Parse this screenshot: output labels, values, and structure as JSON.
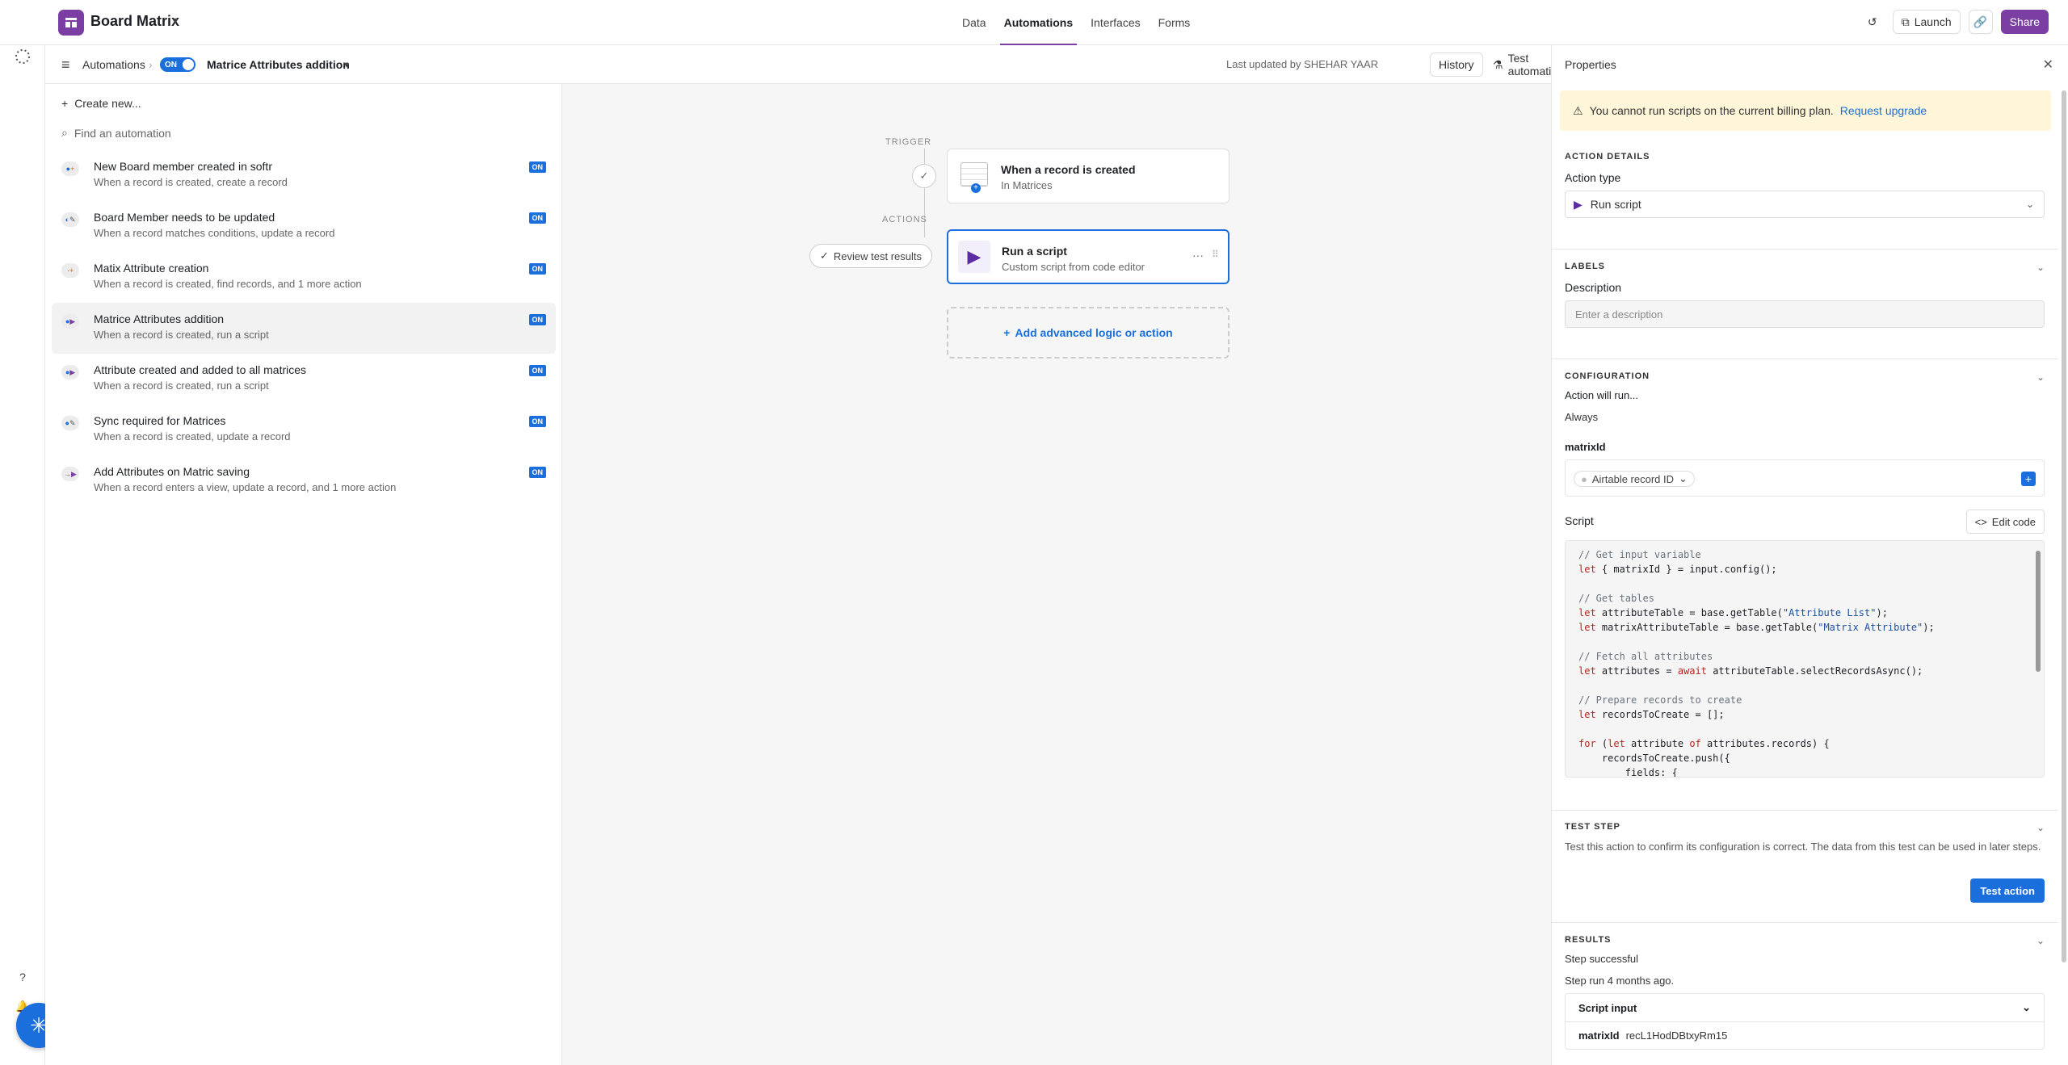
{
  "app": {
    "base_name": "Board Matrix",
    "nav_tabs": [
      "Data",
      "Automations",
      "Interfaces",
      "Forms"
    ],
    "active_tab": "Automations",
    "launch_label": "Launch",
    "share_label": "Share"
  },
  "subbar": {
    "breadcrumb": "Automations",
    "toggle_label": "ON",
    "automation_name": "Matrice Attributes addition",
    "last_updated": "Last updated by SHEHAR YAAR",
    "history_label": "History",
    "test_label": "Test automation"
  },
  "left": {
    "create_label": "Create new...",
    "find_placeholder": "Find an automation",
    "automations": [
      {
        "title": "New Board member created in softr",
        "subtitle": "When a record is created, create a record",
        "status": "ON",
        "action_icon": "plus"
      },
      {
        "title": "Board Member needs to be updated",
        "subtitle": "When a record matches conditions, update a record",
        "status": "ON",
        "action_icon": "pencil"
      },
      {
        "title": "Matix Attribute creation",
        "subtitle": "When a record is created, find records, and 1 more action",
        "status": "ON",
        "action_icon": "plus"
      },
      {
        "title": "Matrice Attributes addition",
        "subtitle": "When a record is created, run a script",
        "status": "ON",
        "action_icon": "play"
      },
      {
        "title": "Attribute created and added to all matrices",
        "subtitle": "When a record is created, run a script",
        "status": "ON",
        "action_icon": "play"
      },
      {
        "title": "Sync required for Matrices",
        "subtitle": "When a record is created, update a record",
        "status": "ON",
        "action_icon": "pencil"
      },
      {
        "title": "Add Attributes on Matric saving",
        "subtitle": "When a record enters a view, update a record, and 1 more action",
        "status": "ON",
        "action_icon": "play"
      }
    ]
  },
  "canvas": {
    "trigger_label": "TRIGGER",
    "actions_label": "ACTIONS",
    "trigger_title": "When a record is created",
    "trigger_sub": "In Matrices",
    "action_title": "Run a script",
    "action_sub": "Custom script from code editor",
    "review_label": "Review test results",
    "add_logic_label": "Add advanced logic or action"
  },
  "props": {
    "title": "Properties",
    "warning_text": "You cannot run scripts on the current billing plan.",
    "warning_link": "Request upgrade",
    "action_details_h": "ACTION DETAILS",
    "action_type_label": "Action type",
    "action_type_value": "Run script",
    "labels_h": "LABELS",
    "description_label": "Description",
    "description_placeholder": "Enter a description",
    "config_h": "CONFIGURATION",
    "will_run_label": "Action will run...",
    "will_run_value": "Always",
    "var_name": "matrixId",
    "var_value": "Airtable record ID",
    "script_label": "Script",
    "edit_code_label": "Edit code",
    "test_step_h": "TEST STEP",
    "test_step_text": "Test this action to confirm its configuration is correct. The data from this test can be used in later steps.",
    "test_action_label": "Test action",
    "results_h": "RESULTS",
    "results_status": "Step successful",
    "results_time": "Step run 4 months ago.",
    "script_input_label": "Script input",
    "input_key": "matrixId",
    "input_value": "recL1HodDBtxyRm15"
  },
  "colors": {
    "accent": "#7b3fa3",
    "link": "#1a6fdc",
    "warning_bg": "#fff5d9"
  }
}
